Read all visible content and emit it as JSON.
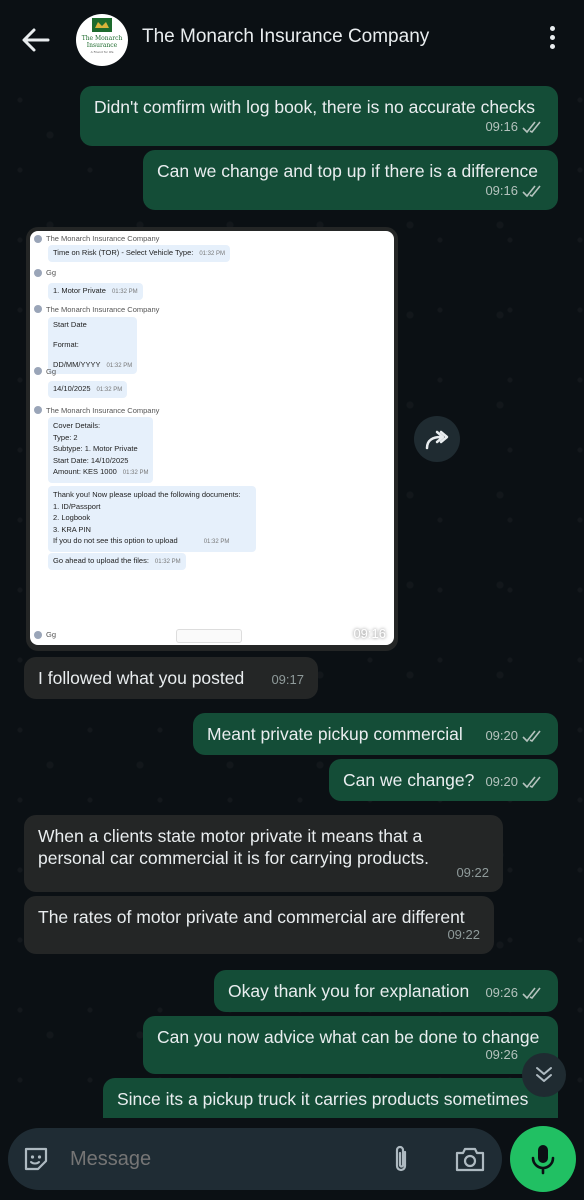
{
  "header": {
    "title": "The Monarch Insurance Company",
    "avatar_line1": "The Monarch",
    "avatar_line2": "Insurance",
    "avatar_line3": "A Friend for life"
  },
  "messages": [
    {
      "dir": "out",
      "text": "Didn't comfirm with log book, there is no accurate checks",
      "time": "09:16"
    },
    {
      "dir": "out",
      "text": "Can we change and top up if there is a difference",
      "time": "09:16"
    },
    {
      "dir": "in",
      "type": "image",
      "time": "09:16"
    },
    {
      "dir": "in",
      "text": "I followed what you posted",
      "time": "09:17"
    },
    {
      "dir": "out",
      "text": "Meant private pickup commercial",
      "time": "09:20"
    },
    {
      "dir": "out",
      "text": "Can we change?",
      "time": "09:20"
    },
    {
      "dir": "in",
      "text": "When a clients state motor private it means that a personal car commercial it is for carrying products.",
      "time": "09:22"
    },
    {
      "dir": "in",
      "text": "The rates of motor private and commercial are different",
      "time": "09:22"
    },
    {
      "dir": "out",
      "text": "Okay thank you for explanation",
      "time": "09:26"
    },
    {
      "dir": "out",
      "text": "Can you now advice what can be done to change",
      "time": "09:26"
    },
    {
      "dir": "out",
      "text": "Since its a pickup truck it carries products sometimes",
      "time": ""
    }
  ],
  "screenshot": {
    "company": "The Monarch Insurance Company",
    "user": "Gg",
    "t": "01:32 PM",
    "tor": "Time on Risk (TOR) - Select Vehicle Type:",
    "motor_private": "1. Motor Private",
    "start_date": "Start Date",
    "format": "Format:",
    "fmt": "DD/MM/YYYY",
    "date": "14/10/2025",
    "cover_details": "Cover Details:",
    "type": "Type: 2",
    "subtype": "Subtype: 1. Motor Private",
    "start": "Start Date: 14/10/2025",
    "amount": "Amount: KES 1000",
    "thanks": "Thank you! Now please upload the following documents:",
    "doc1": "1. ID/Passport",
    "doc2": "2. Logbook",
    "doc3": "3. KRA PIN",
    "no_option": "If you do not see this option to upload",
    "go_ahead": "Go ahead to upload the files:"
  },
  "composer": {
    "placeholder": "Message"
  },
  "colors": {
    "outgoing": "#144d37",
    "incoming": "#242626",
    "accent": "#21c063",
    "background": "#0b1014"
  },
  "icons": [
    "back-arrow-icon",
    "more-options-icon",
    "double-check-icon",
    "forward-icon",
    "scroll-down-icon",
    "sticker-icon",
    "attach-icon",
    "camera-icon",
    "mic-icon"
  ]
}
